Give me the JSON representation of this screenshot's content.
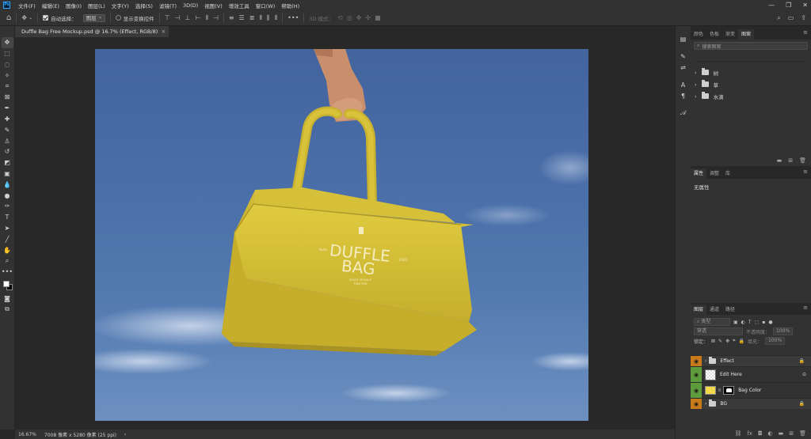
{
  "app": {
    "logo": "Ps"
  },
  "menu": [
    "文件(F)",
    "编辑(E)",
    "图像(I)",
    "图层(L)",
    "文字(Y)",
    "选择(S)",
    "滤镜(T)",
    "3D(D)",
    "视图(V)",
    "增效工具",
    "窗口(W)",
    "帮助(H)"
  ],
  "window_controls": {
    "minimize": "—",
    "restore": "❐",
    "close": "✕"
  },
  "options": {
    "auto_select_label": "自动选择：",
    "auto_select_value": "图层",
    "show_transform_label": "显示变换控件",
    "mode_3d_label": "3D 模式："
  },
  "document": {
    "tab_title": "Duffle Bag Free Mockup.psd @ 16.7% (Effect, RGB/8)",
    "close": "×"
  },
  "status": {
    "zoom": "16.67%",
    "size": "7008 像素 x 5280 像素 (25 ppi)",
    "arrow": "›"
  },
  "mockup": {
    "text_duffle": "DUFFLE",
    "text_bag": "BAG",
    "text_left": "Kulo",
    "text_right": "2021",
    "text_small1": "READY MOCKUP",
    "text_small2": "FREE PSD"
  },
  "swatches_panel": {
    "tabs": [
      "颜色",
      "色板",
      "渐变",
      "图案"
    ],
    "search_placeholder": "搜索图案",
    "folders": [
      "树",
      "草",
      "水滴"
    ]
  },
  "properties_panel": {
    "tabs": [
      "属性",
      "调整",
      "库"
    ],
    "content": "无属性"
  },
  "layers_panel": {
    "tabs": [
      "图层",
      "通道",
      "路径"
    ],
    "kind_label": "类型",
    "blend_mode": "穿透",
    "opacity_label": "不透明度：",
    "opacity_value": "100%",
    "lock_label": "锁定：",
    "fill_label": "填充：",
    "fill_value": "100%",
    "layers": [
      {
        "name": "Effect",
        "type": "group",
        "eye_color": "#c97b1b"
      },
      {
        "name": "Edit Here",
        "type": "smart",
        "eye_color": "#5e9b3c"
      },
      {
        "name": "Bag Color",
        "type": "fill",
        "eye_color": "#5e9b3c"
      },
      {
        "name": "BG",
        "type": "group",
        "eye_color": "#c97b1b"
      }
    ],
    "bag_color": "#f3d94a"
  },
  "colors": {
    "bag": "#d8c33a",
    "sky": "#4a6ea8"
  }
}
